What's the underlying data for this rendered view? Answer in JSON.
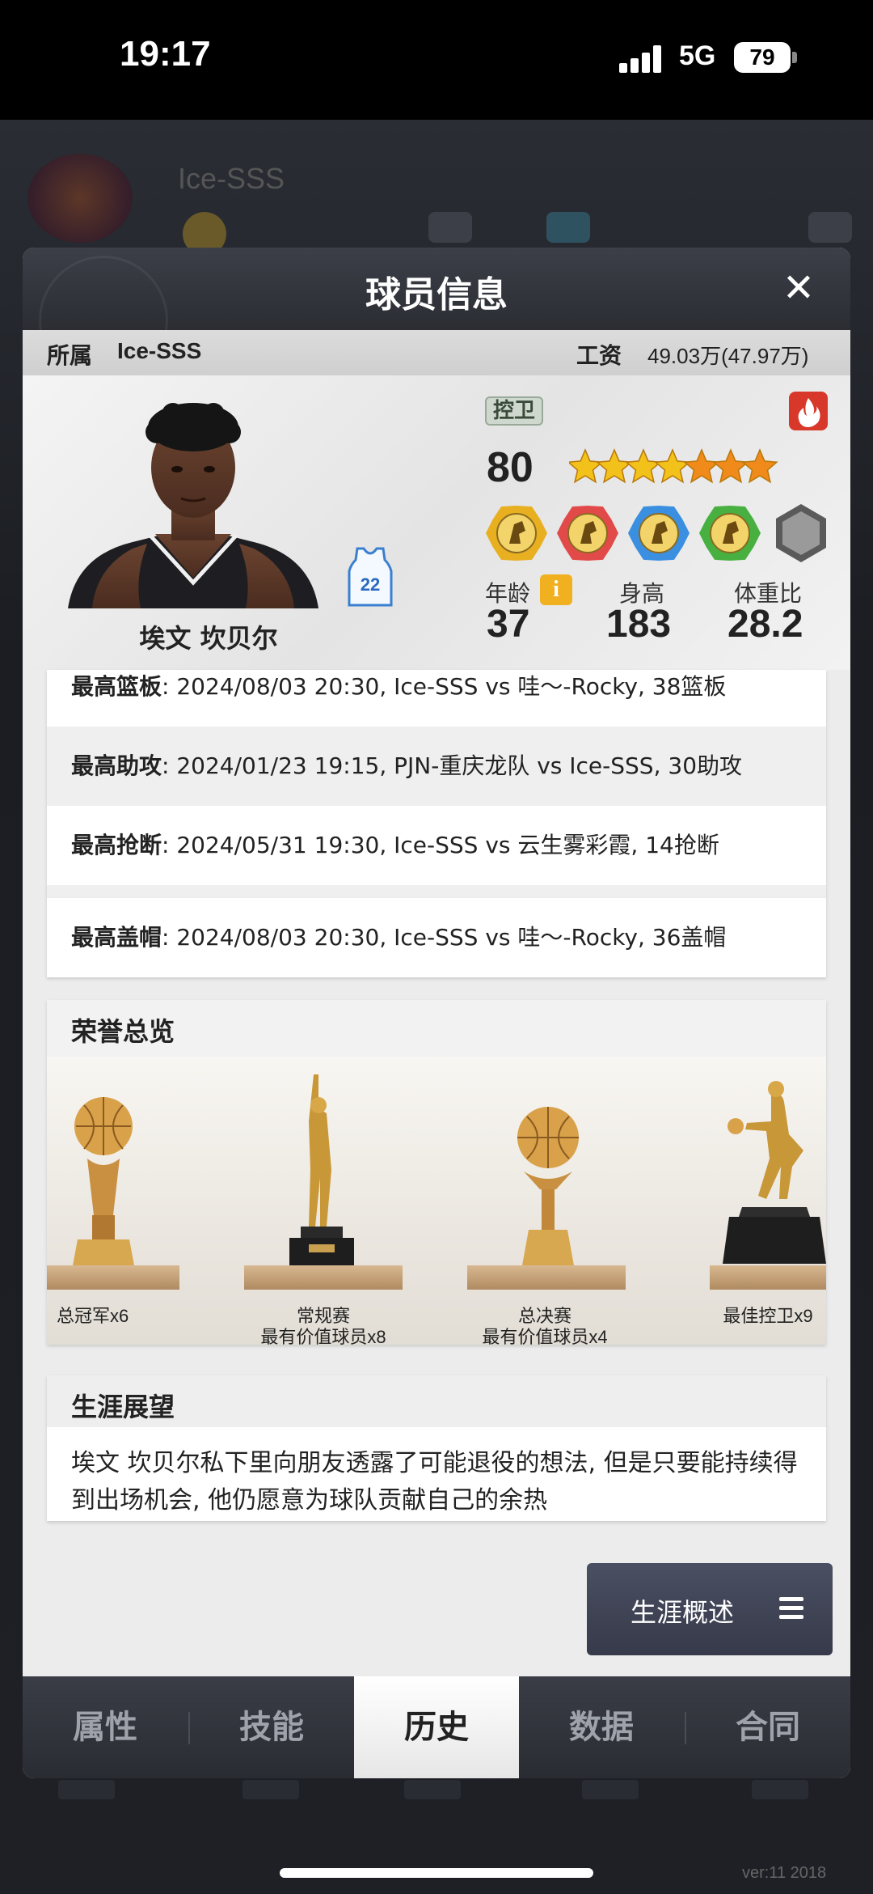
{
  "status_bar": {
    "time": "19:17",
    "network": "5G",
    "battery": "79"
  },
  "background": {
    "team_name": "Ice-SSS",
    "version": "ver:11  2018"
  },
  "modal": {
    "title": "球员信息",
    "close_label": "✕",
    "team_label": "所属",
    "team_name": "Ice-SSS",
    "salary_label": "工资",
    "salary_value": "49.03万(47.97万)"
  },
  "player": {
    "name": "埃文 坎贝尔",
    "jersey_number": "22",
    "position": "控卫",
    "rating": "80",
    "stars_total": 7,
    "stars_gold": 4,
    "stats": {
      "age_label": "年龄",
      "age": "37",
      "height_label": "身高",
      "height": "183",
      "bmi_label": "体重比",
      "bmi": "28.2"
    },
    "badge_icons": [
      "gold-badge-icon",
      "red-badge-icon",
      "blue-badge-icon",
      "green-badge-icon",
      "gray-badge-icon"
    ]
  },
  "records": [
    {
      "label": "最高篮板",
      "text": ": 2024/08/03 20:30, Ice-SSS vs 哇～-Rocky, 38篮板"
    },
    {
      "label": "最高助攻",
      "text": ": 2024/01/23 19:15, PJN-重庆龙队 vs Ice-SSS, 30助攻"
    },
    {
      "label": "最高抢断",
      "text": ": 2024/05/31 19:30, Ice-SSS vs 云生雾彩霞, 14抢断"
    },
    {
      "label": "最高盖帽",
      "text": ": 2024/08/03 20:30, Ice-SSS vs 哇～-Rocky, 36盖帽"
    }
  ],
  "honors": {
    "title": "荣誉总览",
    "items": [
      {
        "line1": "总冠军x6",
        "line2": ""
      },
      {
        "line1": "常规赛",
        "line2": "最有价值球员x8"
      },
      {
        "line1": "总决赛",
        "line2": "最有价值球员x4"
      },
      {
        "line1": "最佳控卫x9",
        "line2": ""
      }
    ]
  },
  "outlook": {
    "title": "生涯展望",
    "text": "埃文 坎贝尔私下里向朋友透露了可能退役的想法, 但是只要能持续得到出场机会, 他仍愿意为球队贡献自己的余热"
  },
  "summary_button": {
    "label": "生涯概述"
  },
  "tabs": [
    {
      "label": "属性",
      "active": false
    },
    {
      "label": "技能",
      "active": false
    },
    {
      "label": "历史",
      "active": true
    },
    {
      "label": "数据",
      "active": false
    },
    {
      "label": "合同",
      "active": false
    }
  ],
  "colors": {
    "header_bg": "#2b2d33",
    "badge_gold": "#e8b020",
    "badge_red": "#e24a4a",
    "badge_blue": "#3a8fe0",
    "badge_green": "#48b040",
    "star_gold": "#f2c21a",
    "star_orange": "#f08a1a",
    "info_icon": "#f0b020",
    "fire_icon": "#d8382a"
  }
}
